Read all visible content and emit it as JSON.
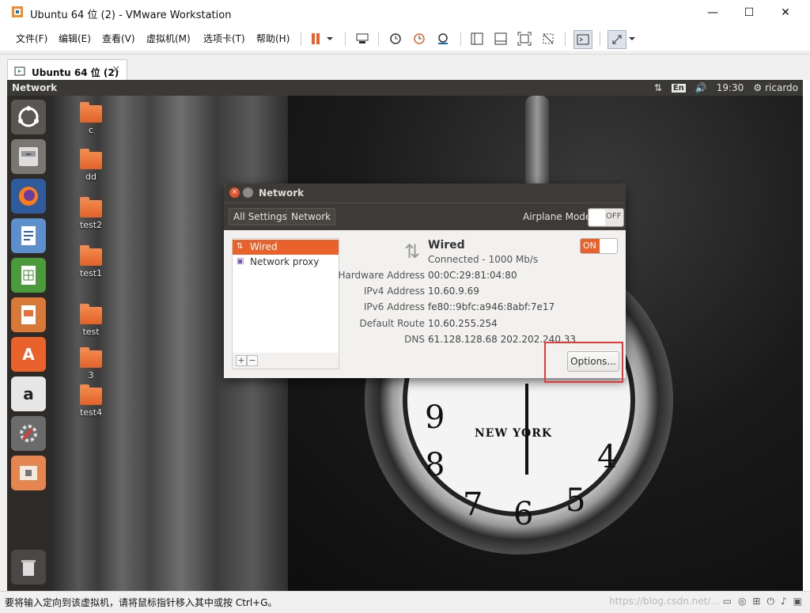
{
  "window": {
    "title": "Ubuntu 64 位 (2) - VMware Workstation",
    "min_glyph": "—",
    "max_glyph": "☐",
    "close_glyph": "✕"
  },
  "menubar": {
    "items": [
      "文件(F)",
      "编辑(E)",
      "查看(V)",
      "虚拟机(M)",
      "选项卡(T)",
      "帮助(H)"
    ]
  },
  "tab": {
    "label": "Ubuntu 64 位 (2)",
    "close": "✕"
  },
  "ubuntu_panel": {
    "title": "Network",
    "lang": "En",
    "time": "19:30",
    "user": "ricardo"
  },
  "desktop_icons": [
    "c",
    "dd",
    "test2",
    "test1",
    "test",
    "3",
    "test4"
  ],
  "network_dialog": {
    "title": "Network",
    "crumbs": [
      "All Settings",
      "Network"
    ],
    "airplane_label": "Airplane Mode",
    "airplane_state": "OFF",
    "list": [
      "Wired",
      "Network proxy"
    ],
    "selected_index": 0,
    "wired_title": "Wired",
    "wired_status": "Connected - 1000 Mb/s",
    "wired_toggle": "ON",
    "details": [
      {
        "key": "Hardware Address",
        "value": "00:0C:29:81:04:80"
      },
      {
        "key": "IPv4 Address",
        "value": "10.60.9.69"
      },
      {
        "key": "IPv6 Address",
        "value": "fe80::9bfc:a946:8abf:7e17"
      },
      {
        "key": "Default Route",
        "value": "10.60.255.254"
      },
      {
        "key": "DNS",
        "value": "61.128.128.68 202.202.240.33"
      }
    ],
    "options_label": "Options...",
    "add": "+",
    "remove": "−"
  },
  "clock": {
    "brand": "NEW YORK",
    "numbers": [
      "8",
      "7",
      "6",
      "5",
      "4",
      "9"
    ]
  },
  "statusbar": {
    "text": "要将输入定向到该虚拟机，请将鼠标指针移入其中或按 Ctrl+G。",
    "watermark": "https://blog.csdn.net/..."
  },
  "colors": {
    "accent": "#e9622b",
    "highlight": "#e53a3a",
    "panel": "#3a3935"
  }
}
